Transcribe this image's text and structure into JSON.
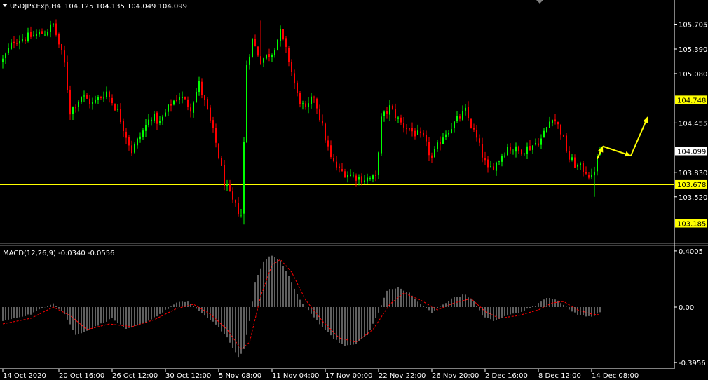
{
  "header": {
    "symbol_label": "USDJPY.Exp,H4",
    "ohlc_label": "104.125 104.135 104.049 104.099"
  },
  "indicator": {
    "label": "MACD(12,26,9) -0.0340 -0.0556"
  },
  "colors": {
    "background": "#000000",
    "bull": "#00ff00",
    "bear": "#ff0000",
    "level_line": "#ffff00",
    "price_line": "#a0a0a0",
    "macd_hist": "#c0c0c0",
    "macd_signal": "#ff0000",
    "arrow": "#ffff00",
    "axis": "#ffffff"
  },
  "chart_data": [
    {
      "type": "candlestick",
      "name": "price",
      "ylim": [
        102.95,
        105.94
      ],
      "y_ticks": [
        "105.705",
        "105.390",
        "105.080",
        "104.455",
        "103.830",
        "103.520"
      ],
      "x_tick_labels": [
        "14 Oct 2020",
        "20 Oct 16:00",
        "26 Oct 12:00",
        "30 Oct 12:00",
        "5 Nov 08:00",
        "11 Nov 04:00",
        "17 Nov 00:00",
        "22 Nov 22:00",
        "26 Nov 20:00",
        "2 Dec 16:00",
        "8 Dec 12:00",
        "14 Dec 08:00"
      ],
      "x_tick_bar_index": [
        0,
        20,
        39,
        58,
        77,
        96,
        115,
        134,
        153,
        172,
        191,
        210
      ],
      "close_path": [
        [
          0,
          105.25
        ],
        [
          4,
          105.5
        ],
        [
          10,
          105.55
        ],
        [
          15,
          105.6
        ],
        [
          18,
          105.7
        ],
        [
          22,
          105.2
        ],
        [
          24,
          104.6
        ],
        [
          28,
          104.8
        ],
        [
          32,
          104.7
        ],
        [
          37,
          104.85
        ],
        [
          41,
          104.6
        ],
        [
          46,
          104.1
        ],
        [
          50,
          104.35
        ],
        [
          53,
          104.55
        ],
        [
          56,
          104.45
        ],
        [
          60,
          104.7
        ],
        [
          63,
          104.8
        ],
        [
          67,
          104.65
        ],
        [
          70,
          104.95
        ],
        [
          73,
          104.6
        ],
        [
          76,
          104.2
        ],
        [
          79,
          103.7
        ],
        [
          82,
          103.45
        ],
        [
          85,
          103.3
        ],
        [
          86,
          104.2
        ],
        [
          87,
          105.2
        ],
        [
          89,
          105.5
        ],
        [
          92,
          105.25
        ],
        [
          96,
          105.35
        ],
        [
          99,
          105.6
        ],
        [
          102,
          105.25
        ],
        [
          105,
          104.8
        ],
        [
          108,
          104.6
        ],
        [
          111,
          104.8
        ],
        [
          114,
          104.4
        ],
        [
          117,
          104.0
        ],
        [
          120,
          103.85
        ],
        [
          124,
          103.8
        ],
        [
          128,
          103.75
        ],
        [
          133,
          103.75
        ],
        [
          135,
          104.5
        ],
        [
          138,
          104.65
        ],
        [
          142,
          104.45
        ],
        [
          146,
          104.35
        ],
        [
          150,
          104.25
        ],
        [
          153,
          104.0
        ],
        [
          157,
          104.3
        ],
        [
          161,
          104.45
        ],
        [
          165,
          104.6
        ],
        [
          169,
          104.25
        ],
        [
          173,
          103.85
        ],
        [
          176,
          103.95
        ],
        [
          180,
          104.15
        ],
        [
          184,
          104.1
        ],
        [
          188,
          104.15
        ],
        [
          192,
          104.25
        ],
        [
          196,
          104.55
        ],
        [
          199,
          104.35
        ],
        [
          202,
          104.0
        ],
        [
          205,
          103.9
        ],
        [
          208,
          103.85
        ],
        [
          210,
          103.75
        ],
        [
          212,
          104.0
        ],
        [
          213,
          104.099
        ]
      ],
      "wick_extremes": {
        "high": 105.75,
        "low": 103.17,
        "spike_low": 103.52
      },
      "horizontal_levels": [
        {
          "value": 104.748,
          "label": "104.748",
          "style": "level"
        },
        {
          "value": 104.099,
          "label": "104.099",
          "style": "price"
        },
        {
          "value": 103.678,
          "label": "103.678",
          "style": "level"
        },
        {
          "value": 103.185,
          "label": "103.185",
          "style": "level"
        }
      ],
      "projection_arrow": [
        [
          212,
          104.0
        ],
        [
          214,
          104.16
        ],
        [
          224,
          104.04
        ],
        [
          230,
          104.53
        ]
      ]
    },
    {
      "type": "histogram_line",
      "name": "MACD",
      "ylim": [
        -0.43,
        0.43
      ],
      "y_ticks": [
        "0.4005",
        "0.00",
        "-0.3956"
      ],
      "macd_path": [
        [
          0,
          -0.1
        ],
        [
          10,
          -0.05
        ],
        [
          18,
          0.03
        ],
        [
          22,
          -0.05
        ],
        [
          26,
          -0.2
        ],
        [
          32,
          -0.15
        ],
        [
          39,
          -0.08
        ],
        [
          44,
          -0.16
        ],
        [
          50,
          -0.12
        ],
        [
          56,
          -0.05
        ],
        [
          62,
          0.03
        ],
        [
          66,
          0.04
        ],
        [
          70,
          -0.03
        ],
        [
          76,
          -0.12
        ],
        [
          80,
          -0.22
        ],
        [
          84,
          -0.36
        ],
        [
          86,
          -0.3
        ],
        [
          88,
          -0.1
        ],
        [
          90,
          0.18
        ],
        [
          93,
          0.33
        ],
        [
          96,
          0.37
        ],
        [
          99,
          0.33
        ],
        [
          102,
          0.22
        ],
        [
          106,
          0.05
        ],
        [
          110,
          -0.05
        ],
        [
          114,
          -0.14
        ],
        [
          118,
          -0.22
        ],
        [
          122,
          -0.28
        ],
        [
          126,
          -0.26
        ],
        [
          130,
          -0.2
        ],
        [
          134,
          -0.04
        ],
        [
          137,
          0.12
        ],
        [
          141,
          0.14
        ],
        [
          145,
          0.1
        ],
        [
          149,
          0.02
        ],
        [
          153,
          -0.04
        ],
        [
          157,
          0.02
        ],
        [
          161,
          0.07
        ],
        [
          165,
          0.09
        ],
        [
          168,
          0.04
        ],
        [
          171,
          -0.06
        ],
        [
          175,
          -0.1
        ],
        [
          180,
          -0.06
        ],
        [
          185,
          -0.03
        ],
        [
          190,
          0.01
        ],
        [
          194,
          0.07
        ],
        [
          198,
          0.05
        ],
        [
          202,
          -0.02
        ],
        [
          206,
          -0.06
        ],
        [
          210,
          -0.07
        ],
        [
          213,
          -0.034
        ]
      ],
      "signal_path": [
        [
          0,
          -0.12
        ],
        [
          10,
          -0.08
        ],
        [
          18,
          0.0
        ],
        [
          24,
          -0.06
        ],
        [
          30,
          -0.16
        ],
        [
          38,
          -0.12
        ],
        [
          46,
          -0.14
        ],
        [
          54,
          -0.09
        ],
        [
          62,
          -0.01
        ],
        [
          68,
          0.02
        ],
        [
          74,
          -0.05
        ],
        [
          80,
          -0.16
        ],
        [
          85,
          -0.3
        ],
        [
          88,
          -0.25
        ],
        [
          92,
          0.08
        ],
        [
          96,
          0.3
        ],
        [
          99,
          0.34
        ],
        [
          103,
          0.25
        ],
        [
          108,
          0.05
        ],
        [
          114,
          -0.1
        ],
        [
          120,
          -0.22
        ],
        [
          126,
          -0.25
        ],
        [
          132,
          -0.16
        ],
        [
          138,
          0.02
        ],
        [
          143,
          0.1
        ],
        [
          149,
          0.05
        ],
        [
          155,
          -0.02
        ],
        [
          161,
          0.03
        ],
        [
          167,
          0.06
        ],
        [
          172,
          -0.03
        ],
        [
          177,
          -0.08
        ],
        [
          184,
          -0.06
        ],
        [
          191,
          -0.02
        ],
        [
          196,
          0.03
        ],
        [
          200,
          0.04
        ],
        [
          205,
          -0.02
        ],
        [
          210,
          -0.05
        ],
        [
          213,
          -0.0556
        ]
      ]
    }
  ]
}
